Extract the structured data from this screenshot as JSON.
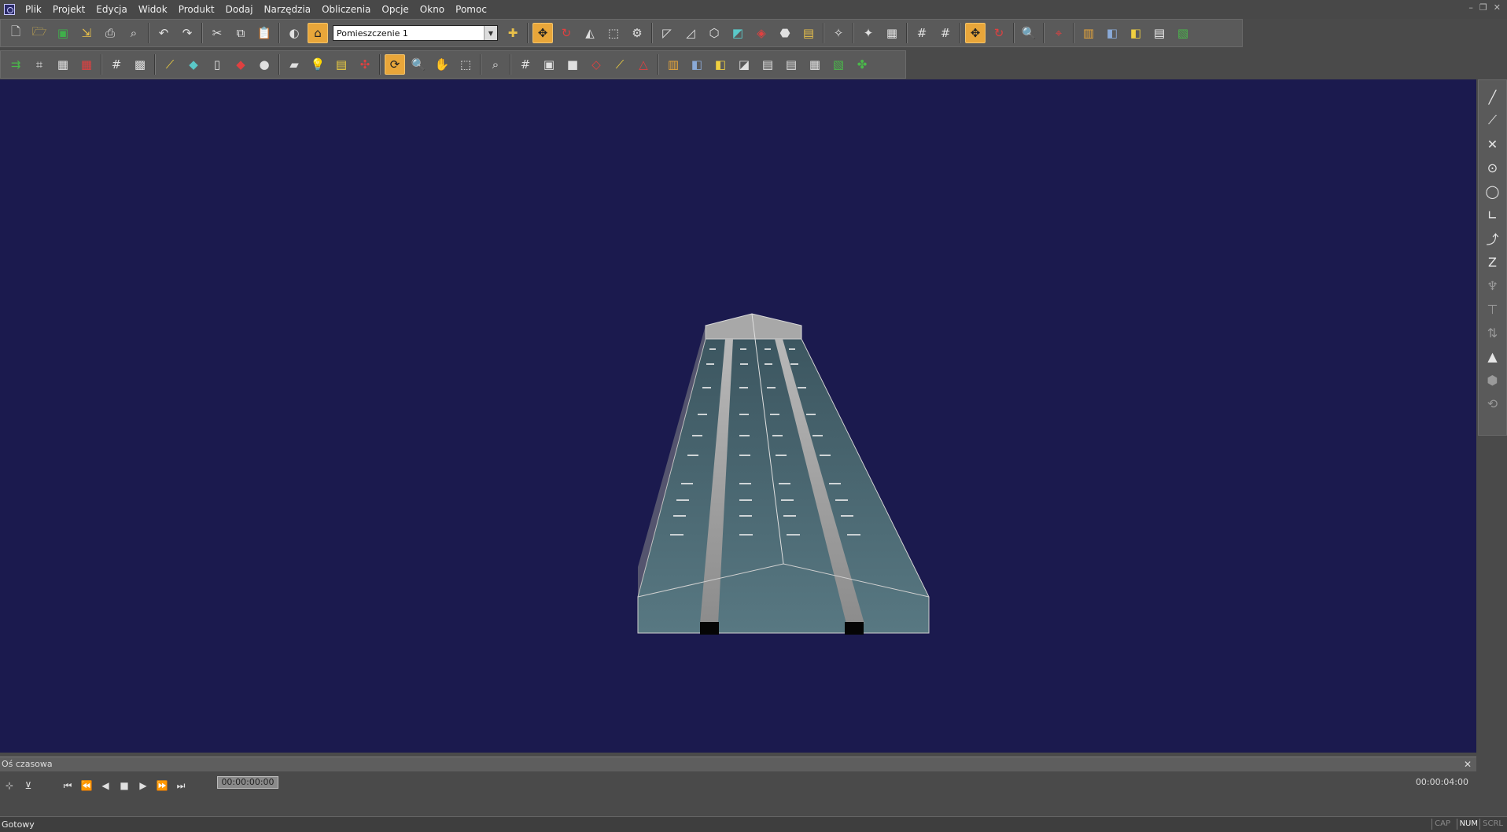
{
  "menu": [
    "Plik",
    "Projekt",
    "Edycja",
    "Widok",
    "Produkt",
    "Dodaj",
    "Narzędzia",
    "Obliczenia",
    "Opcje",
    "Okno",
    "Pomoc"
  ],
  "window_controls": [
    "–",
    "❐",
    "✕"
  ],
  "toolbar": {
    "room_select": "Pomieszczenie 1",
    "row1_icons": [
      "new-file-icon",
      "open-folder-icon",
      "save-icon",
      "import-icon",
      "print-icon",
      "print-preview-icon",
      "undo-icon",
      "redo-icon",
      "cut-icon",
      "copy-icon",
      "paste-icon",
      "glasses-view-icon",
      "room-view-icon",
      "add-luminaire-icon",
      "move-icon",
      "rotate-icon",
      "scale-icon",
      "transform-icon",
      "align-icon",
      "select-vertex-icon",
      "edit-vertex-icon",
      "edit-face-icon",
      "paint-icon",
      "material-icon",
      "hammer-icon",
      "measure-icon",
      "probe-icon",
      "render-icon",
      "film-icon",
      "grid-icon",
      "snap-grid-icon",
      "move-active-icon",
      "rotate-icon-2",
      "zoom-find-icon",
      "dimension-icon",
      "results-icon",
      "cube-icon",
      "cube-yellow-icon",
      "report-icon",
      "report-color-icon"
    ],
    "row2_icons": [
      "add-arrow-icon",
      "grid-a-icon",
      "grid-b-icon",
      "grid-c-icon",
      "hash-icon",
      "hash-box-icon",
      "lamp-icon",
      "slab-icon",
      "wall-icon",
      "floor-icon",
      "sphere-icon",
      "beam-icon",
      "light-bulb-icon",
      "calc-icon",
      "calc-grid-icon",
      "orbit-icon",
      "zoom-icon",
      "pan-icon",
      "zoom-window-icon",
      "zoom-fit-icon",
      "grid-view-icon",
      "plan-view-icon",
      "texture-icon",
      "plane-icon",
      "spot-icon",
      "tent-icon",
      "front-view-icon",
      "side-view-icon",
      "top-view-icon",
      "persp-view-icon",
      "doc-icon",
      "doc-list-icon",
      "doc-table-icon",
      "green-a-icon",
      "green-b-icon"
    ]
  },
  "right_toolbar_icons": [
    "line-icon",
    "polyline-icon",
    "cross-icon",
    "circle-icon",
    "ring-icon",
    "angle-icon",
    "curve-icon",
    "zigzag-icon",
    "lamp-up-icon",
    "lamp-down-icon",
    "arrow-icon",
    "cone-icon",
    "prism-icon",
    "refresh-icon"
  ],
  "timeline": {
    "title": "Oś czasowa",
    "current_time": "00:00:00:00",
    "end_time": "00:00:04:00"
  },
  "status": {
    "text": "Gotowy",
    "cap": "CAP",
    "num": "NUM",
    "scrl": "SCRL"
  },
  "colors": {
    "viewport_bg": "#1b1a4e",
    "active_tool": "#e8a63a",
    "floor": "#4d6770",
    "wall": "#9a9a9a"
  }
}
